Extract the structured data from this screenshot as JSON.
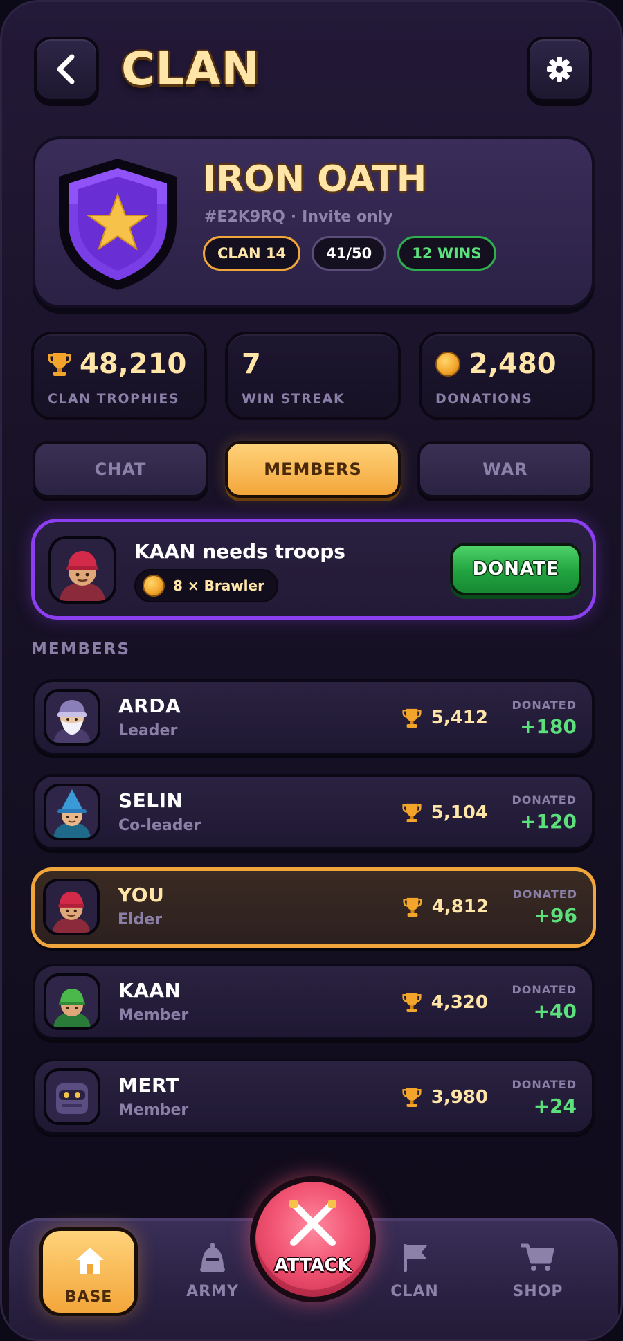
{
  "header": {
    "title": "CLAN",
    "back_icon": "back-arrow-icon",
    "settings_icon": "gear-icon"
  },
  "clan": {
    "name": "IRON OATH",
    "tag": "#E2K9RQ",
    "separator": "·",
    "privacy": "Invite only",
    "level_badge": "CLAN 14",
    "members_badge": "41/50",
    "wins_badge": "12 WINS"
  },
  "stats": [
    {
      "value": "48,210",
      "label": "CLAN TROPHIES",
      "icon": "trophy-icon"
    },
    {
      "value": "7",
      "label": "WIN STREAK"
    },
    {
      "value": "2,480",
      "label": "DONATIONS",
      "icon": "coin-icon"
    }
  ],
  "tabs": [
    {
      "label": "CHAT",
      "active": false
    },
    {
      "label": "MEMBERS",
      "active": true
    },
    {
      "label": "WAR",
      "active": false
    }
  ],
  "request": {
    "title": "KAAN needs troops",
    "item": "8 × Brawler",
    "donate_label": "DONATE"
  },
  "members_section_label": "MEMBERS",
  "members": [
    {
      "name": "ARDA",
      "role": "Leader",
      "trophies": "5,412",
      "donated_label": "DONATED",
      "donated": "+180"
    },
    {
      "name": "SELIN",
      "role": "Co-leader",
      "trophies": "5,104",
      "donated_label": "DONATED",
      "donated": "+120"
    },
    {
      "name": "YOU",
      "role": "Elder",
      "trophies": "4,812",
      "donated_label": "DONATED",
      "donated": "+96"
    },
    {
      "name": "KAAN",
      "role": "Member",
      "trophies": "4,320",
      "donated_label": "DONATED",
      "donated": "+40"
    },
    {
      "name": "MERT",
      "role": "Member",
      "trophies": "3,980",
      "donated_label": "DONATED",
      "donated": "+24"
    }
  ],
  "nav": {
    "base": "BASE",
    "army": "ARMY",
    "attack": "ATTACK",
    "clan": "CLAN",
    "shop": "SHOP"
  },
  "colors": {
    "accent_gold": "#f3a63a",
    "accent_purple": "#8b3ff0",
    "positive_green": "#5ce07c",
    "attack_red": "#f25573"
  }
}
